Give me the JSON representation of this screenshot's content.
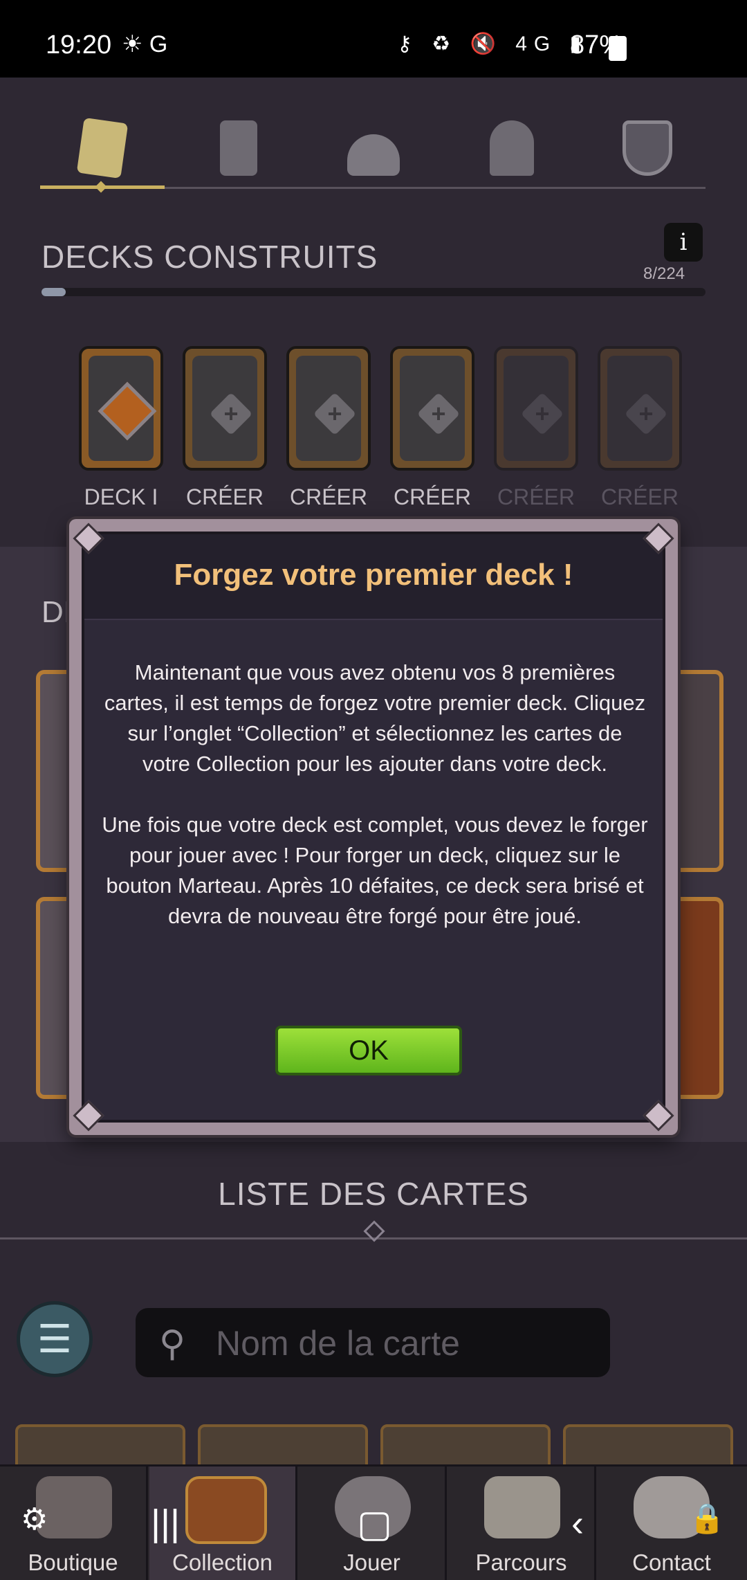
{
  "status_bar": {
    "time": "19:20",
    "left_icons": "☀ G",
    "right_icons": "⚷ ♻ 🔇 4G ▮",
    "battery": "87%"
  },
  "top_tabs": [
    {
      "name": "decks",
      "active": true
    },
    {
      "name": "card"
    },
    {
      "name": "forge"
    },
    {
      "name": "hero"
    },
    {
      "name": "shield"
    }
  ],
  "decks": {
    "title": "DECKS CONSTRUITS",
    "info_label": "i",
    "count": "8/224",
    "progress": 0.036,
    "slots": [
      {
        "label": "DECK I",
        "state": "built"
      },
      {
        "label": "CRÉER",
        "state": "empty"
      },
      {
        "label": "CRÉER",
        "state": "empty"
      },
      {
        "label": "CRÉER",
        "state": "empty"
      },
      {
        "label": "CRÉER",
        "state": "locked"
      },
      {
        "label": "CRÉER",
        "state": "locked"
      }
    ]
  },
  "section_partial_title": "DI",
  "card_list": {
    "title": "LISTE DES CARTES",
    "search_placeholder": "Nom de la carte"
  },
  "modal": {
    "title": "Forgez votre premier deck !",
    "paragraph_1": "Maintenant que vous avez obtenu vos 8 premières cartes, il est temps de forgez votre premier deck. Cliquez sur l’onglet “Collection” et sélectionnez les cartes de votre Collection pour les ajouter dans votre deck.",
    "paragraph_2": "Une fois que votre deck est complet, vous devez le forger pour jouer avec ! Pour forger un deck, cliquez sur le bouton Marteau. Après 10 défaites, ce deck sera brisé et devra de nouveau être forgé pour être joué.",
    "ok_label": "OK"
  },
  "bottom_nav": [
    {
      "label": "Boutique"
    },
    {
      "label": "Collection",
      "active": true
    },
    {
      "label": "Jouer"
    },
    {
      "label": "Parcours"
    },
    {
      "label": "Contact"
    }
  ],
  "colors": {
    "accent_gold": "#c9b060",
    "modal_title": "#f2c07a",
    "ok_green": "#7ccb2a"
  }
}
